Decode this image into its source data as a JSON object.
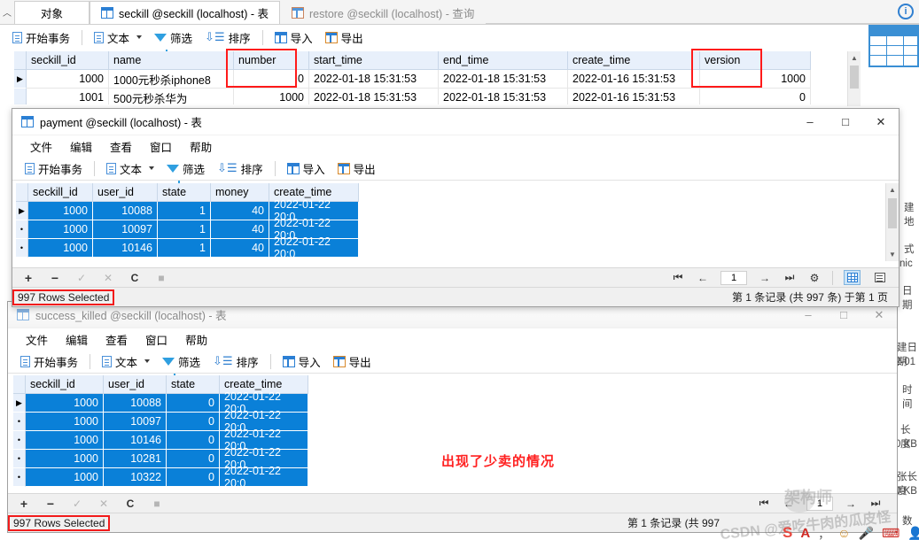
{
  "background_window": {
    "tabs": [
      {
        "label": "对象",
        "icon": "object-icon",
        "state": "active-left"
      },
      {
        "label": "seckill @seckill (localhost) - 表",
        "icon": "table-icon",
        "state": "active"
      },
      {
        "label": "restore @seckill (localhost) - 查询",
        "icon": "query-icon",
        "state": "inactive"
      }
    ],
    "toolbar": [
      {
        "label": "开始事务",
        "icon": "begin-transaction-icon"
      },
      {
        "label": "文本",
        "icon": "text-icon",
        "dropdown": true
      },
      {
        "label": "筛选",
        "icon": "filter-icon"
      },
      {
        "label": "排序",
        "icon": "sort-icon"
      },
      {
        "label": "导入",
        "icon": "import-icon"
      },
      {
        "label": "导出",
        "icon": "export-icon"
      }
    ],
    "grid": {
      "columns": [
        "seckill_id",
        "name",
        "number",
        "start_time",
        "end_time",
        "create_time",
        "version"
      ],
      "rows": [
        [
          "1000",
          "1000元秒杀iphone8",
          "0",
          "2022-01-18 15:31:53",
          "2022-01-18 15:31:53",
          "2022-01-16 15:31:53",
          "1000"
        ],
        [
          "1001",
          "500元秒杀华为",
          "1000",
          "2022-01-18 15:31:53",
          "2022-01-18 15:31:53",
          "2022-01-16 15:31:53",
          "0"
        ]
      ]
    },
    "highlight_boxes": [
      "number-column",
      "version-column"
    ],
    "help_icon": "info-icon"
  },
  "payment_window": {
    "title": "payment @seckill (localhost) - 表",
    "title_icon": "table-icon",
    "controls": {
      "minimize": "–",
      "maximize": "□",
      "close": "✕"
    },
    "menus": [
      "文件",
      "编辑",
      "查看",
      "窗口",
      "帮助"
    ],
    "toolbar": [
      {
        "label": "开始事务",
        "icon": "begin-transaction-icon"
      },
      {
        "label": "文本",
        "icon": "text-icon",
        "dropdown": true
      },
      {
        "label": "筛选",
        "icon": "filter-icon"
      },
      {
        "label": "排序",
        "icon": "sort-icon"
      },
      {
        "label": "导入",
        "icon": "import-icon"
      },
      {
        "label": "导出",
        "icon": "export-icon"
      }
    ],
    "grid": {
      "columns": [
        "seckill_id",
        "user_id",
        "state",
        "money",
        "create_time"
      ],
      "rows": [
        [
          "1000",
          "10088",
          "1",
          "40",
          "2022-01-22 20:0"
        ],
        [
          "1000",
          "10097",
          "1",
          "40",
          "2022-01-22 20:0"
        ],
        [
          "1000",
          "10146",
          "1",
          "40",
          "2022-01-22 20:0"
        ]
      ]
    },
    "record_nav": {
      "first": "⏮",
      "prev": "←",
      "page": "1",
      "next": "→",
      "last": "⏭",
      "settings": "⚙",
      "view_grid": "grid-view-icon",
      "view_form": "form-view-icon"
    },
    "rowops": [
      "+",
      "−",
      "✓",
      "✕",
      "C",
      "■"
    ],
    "status_left": "997 Rows Selected",
    "status_right": "第 1 条记录 (共 997 条) 于第 1 页",
    "status_left_highlighted": true
  },
  "success_killed_window": {
    "title": "success_killed @seckill (localhost) - 表",
    "title_icon": "table-icon",
    "controls": {
      "minimize": "–",
      "maximize": "□",
      "close": "✕"
    },
    "menus": [
      "文件",
      "编辑",
      "查看",
      "窗口",
      "帮助"
    ],
    "toolbar": [
      {
        "label": "开始事务",
        "icon": "begin-transaction-icon"
      },
      {
        "label": "文本",
        "icon": "text-icon",
        "dropdown": true
      },
      {
        "label": "筛选",
        "icon": "filter-icon"
      },
      {
        "label": "排序",
        "icon": "sort-icon"
      },
      {
        "label": "导入",
        "icon": "import-icon"
      },
      {
        "label": "导出",
        "icon": "export-icon"
      }
    ],
    "grid": {
      "columns": [
        "seckill_id",
        "user_id",
        "state",
        "create_time"
      ],
      "rows": [
        [
          "1000",
          "10088",
          "0",
          "2022-01-22 20:0"
        ],
        [
          "1000",
          "10097",
          "0",
          "2022-01-22 20:0"
        ],
        [
          "1000",
          "10146",
          "0",
          "2022-01-22 20:0"
        ],
        [
          "1000",
          "10281",
          "0",
          "2022-01-22 20:0"
        ],
        [
          "1000",
          "10322",
          "0",
          "2022-01-22 20:0"
        ]
      ]
    },
    "annotation": "出现了少卖的情况",
    "annotation_color": "#ff2020",
    "rowops": [
      "+",
      "−",
      "✓",
      "✕",
      "C",
      "■"
    ],
    "record_nav": {
      "first": "⏮",
      "prev": "←",
      "page": "1",
      "next": "→",
      "last": "⏭"
    },
    "status_left": "997 Rows Selected",
    "status_right": "第 1 条记录 (共 997",
    "status_left_highlighted": true
  },
  "right_panel": {
    "fragments": [
      "B",
      "建地",
      "式",
      "nic",
      "日期",
      "建日期",
      "2-01",
      "时间",
      "长度",
      "0 KB",
      "张长度",
      "0 KB",
      "数"
    ]
  },
  "watermark": {
    "csdn": "CSDN @爱吃牛肉的瓜皮怪",
    "wechat": "架构师"
  }
}
